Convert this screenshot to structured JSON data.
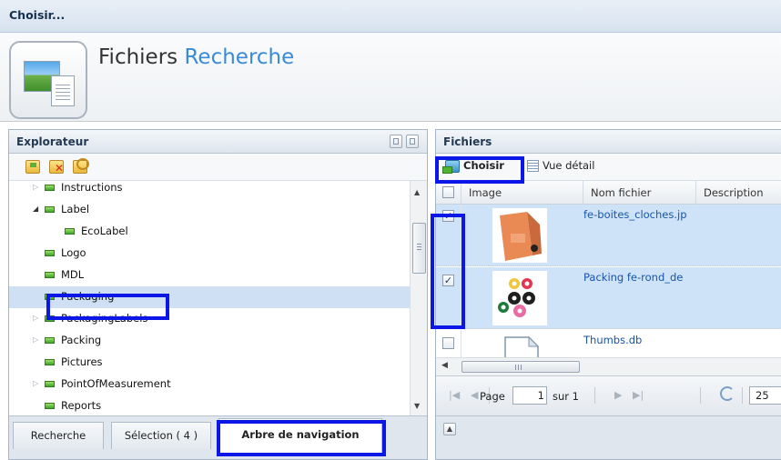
{
  "window": {
    "title": "Choisir..."
  },
  "header": {
    "title_main": "Fichiers",
    "title_accent": "Recherche"
  },
  "explorer": {
    "title": "Explorateur",
    "tree": [
      {
        "label": "Instructions",
        "level": 1,
        "expander": "collapsed",
        "selected": false
      },
      {
        "label": "Label",
        "level": 1,
        "expander": "expanded",
        "selected": false
      },
      {
        "label": "EcoLabel",
        "level": 2,
        "expander": "none",
        "selected": false
      },
      {
        "label": "Logo",
        "level": 1,
        "expander": "none",
        "selected": false
      },
      {
        "label": "MDL",
        "level": 1,
        "expander": "none",
        "selected": false
      },
      {
        "label": "Packaging",
        "level": 1,
        "expander": "none",
        "selected": true
      },
      {
        "label": "PackagingLabels",
        "level": 1,
        "expander": "collapsed",
        "selected": false
      },
      {
        "label": "Packing",
        "level": 1,
        "expander": "collapsed",
        "selected": false
      },
      {
        "label": "Pictures",
        "level": 1,
        "expander": "none",
        "selected": false
      },
      {
        "label": "PointOfMeasurement",
        "level": 1,
        "expander": "collapsed",
        "selected": false
      },
      {
        "label": "Reports",
        "level": 1,
        "expander": "none",
        "selected": false
      }
    ],
    "tabs": [
      {
        "label": "Recherche",
        "active": false
      },
      {
        "label": "Sélection ( 4 )",
        "active": false
      },
      {
        "label": "Arbre de navigation",
        "active": true
      }
    ]
  },
  "files": {
    "title": "Fichiers",
    "toolbar": {
      "choose_label": "Choisir",
      "detail_label": "Vue détail"
    },
    "columns": [
      "Image",
      "Nom fichier",
      "Description"
    ],
    "rows": [
      {
        "checked": true,
        "name": "fe-boites_cloches.jp",
        "thumbnail": "orange-box-photo",
        "selected": true
      },
      {
        "checked": true,
        "name": "Packing fe-rond_de",
        "thumbnail": "colored-rings-photo",
        "selected": true
      },
      {
        "checked": false,
        "name": "Thumbs.db",
        "thumbnail": "generic-file-icon",
        "selected": false
      }
    ],
    "pager": {
      "page_label": "Page",
      "page_value": "1",
      "of_label": "sur 1",
      "page_size": "25"
    }
  },
  "colors": {
    "highlight": "#0a17e6",
    "selection": "#cfe0f5",
    "link": "#1a54a8",
    "accent": "#3a8ad8"
  }
}
